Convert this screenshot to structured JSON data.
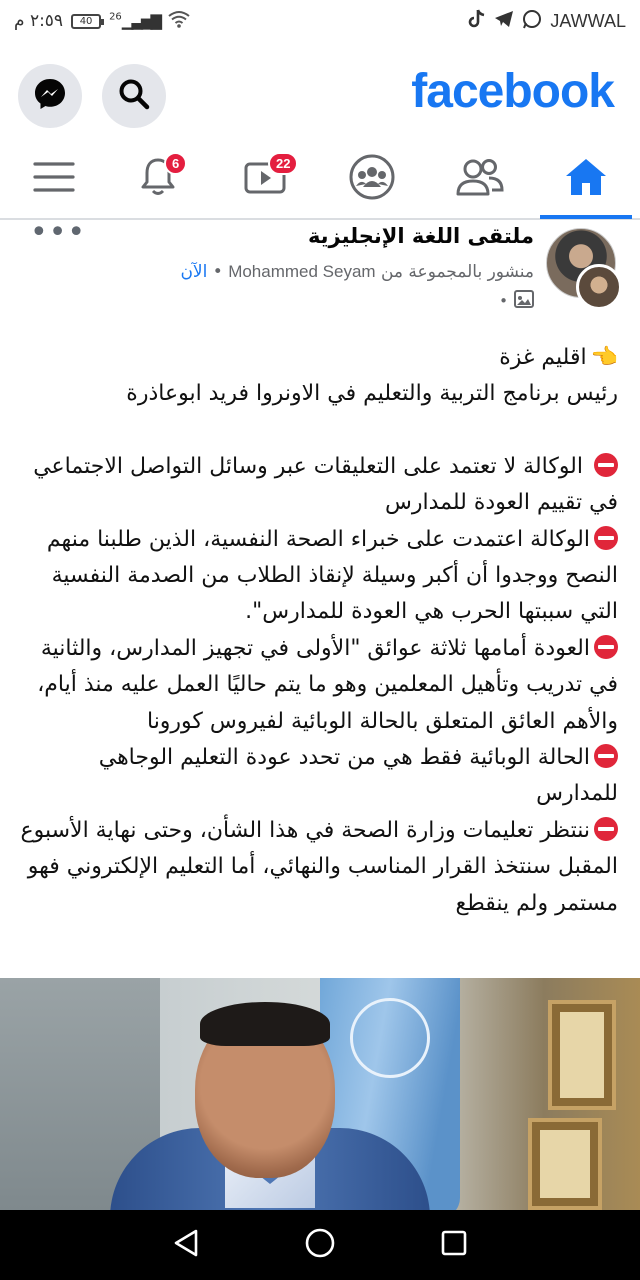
{
  "status_bar": {
    "carrier": "JAWWAL",
    "time": "٢:٥٩ م",
    "battery": "40",
    "network_gen": "26"
  },
  "header": {
    "logo": "facebook",
    "search_icon": "search-icon",
    "messenger_icon": "messenger-icon"
  },
  "nav": {
    "notifications_badge": "6",
    "watch_badge": "22",
    "items": [
      "home-icon",
      "friends-icon",
      "groups-icon",
      "watch-icon",
      "notifications-icon",
      "menu-icon"
    ]
  },
  "post": {
    "group_name": "ملتقى اللغة الإنجليزية",
    "posted_by_prefix": "منشور بالمجموعة من",
    "author": "Mohammed Seyam",
    "time": "الآن",
    "paragraphs": [
      "اقليم غزة",
      "رئيس برنامج التربية والتعليم في الاونروا فريد ابوعاذرة",
      "الوكالة لا تعتمد على التعليقات عبر وسائل التواصل الاجتماعي في تقييم العودة للمدارس",
      "الوكالة اعتمدت على خبراء الصحة النفسية، الذين طلبنا منهم النصح ووجدوا أن أكبر وسيلة لإنقاذ الطلاب من الصدمة النفسية التي سببتها الحرب هي العودة للمدارس\".",
      "العودة أمامها ثلاثة عوائق \"الأولى في تجهيز المدارس، والثانية في تدريب وتأهيل المعلمين وهو ما يتم حاليًا العمل عليه منذ أيام، والأهم العائق المتعلق بالحالة الوبائية لفيروس كورونا",
      "الحالة الوبائية فقط هي من تحدد عودة التعليم الوجاهي للمدارس",
      "ننتظر تعليمات وزارة الصحة في هذا الشأن، وحتى نهاية الأسبوع المقبل سنتخذ القرار المناسب والنهائي، أما التعليم الإلكتروني فهو مستمر ولم ينقطع"
    ]
  },
  "colors": {
    "brand": "#1877f2",
    "badge": "#e41e3f",
    "no_entry": "#e0263a"
  }
}
